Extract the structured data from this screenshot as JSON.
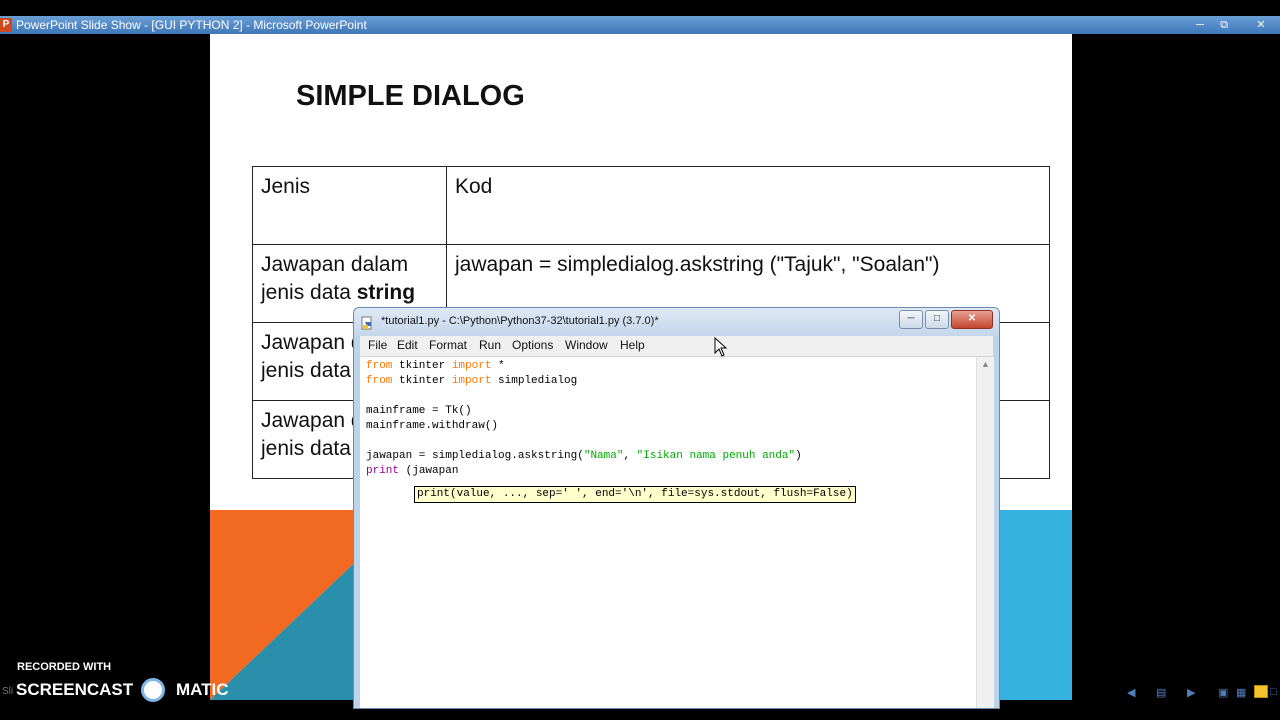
{
  "ppt_window": {
    "icon_letter": "P",
    "title": "PowerPoint Slide Show - [GUI PYTHON  2] - Microsoft PowerPoint",
    "controls": [
      "minimize-icon",
      "restore-icon",
      "close-icon"
    ]
  },
  "slide": {
    "title": "SIMPLE DIALOG",
    "table": {
      "headers": [
        "Jenis",
        "Kod"
      ],
      "rows": [
        {
          "type_prefix": "Jawapan dalam jenis data ",
          "type_bold": "string",
          "code": "jawapan = simpledialog.askstring (\"Tajuk\", \"Soalan\")"
        },
        {
          "type_prefix": "Jawapan dalam jenis data",
          "type_bold": "",
          "code": ""
        },
        {
          "type_prefix": "Jawapan dalam jenis data",
          "type_bold": "",
          "code": ""
        }
      ]
    },
    "colors": {
      "orange": "#f26a21",
      "teal": "#2a8fab",
      "sky": "#35b1e0"
    }
  },
  "idle_window": {
    "title": "*tutorial1.py - C:\\Python\\Python37-32\\tutorial1.py (3.7.0)*",
    "menu": [
      "File",
      "Edit",
      "Format",
      "Run",
      "Options",
      "Window",
      "Help"
    ],
    "code": {
      "line1": {
        "kw1": "from",
        "mod": " tkinter ",
        "kw2": "import",
        "rest": " *"
      },
      "line2": {
        "kw1": "from",
        "mod": " tkinter ",
        "kw2": "import",
        "rest": " simpledialog"
      },
      "line4": "mainframe = Tk()",
      "line5": "mainframe.withdraw()",
      "line7": {
        "lhs": "jawapan = simpledialog.askstring(",
        "arg1": "\"Nama\"",
        "sep": ", ",
        "arg2": "\"Isikan nama penuh anda\"",
        "end": ")"
      },
      "line8": {
        "builtin": "print",
        "rest": " (jawapan"
      }
    },
    "calltip": "print(value, ..., sep=' ', end='\\n', file=sys.stdout, flush=False)"
  },
  "watermark": {
    "recorded_with": "RECORDED WITH",
    "brand_left": "SCREENCAST",
    "brand_right": "MATIC"
  },
  "status_bar": {
    "left_text": "Sli"
  }
}
